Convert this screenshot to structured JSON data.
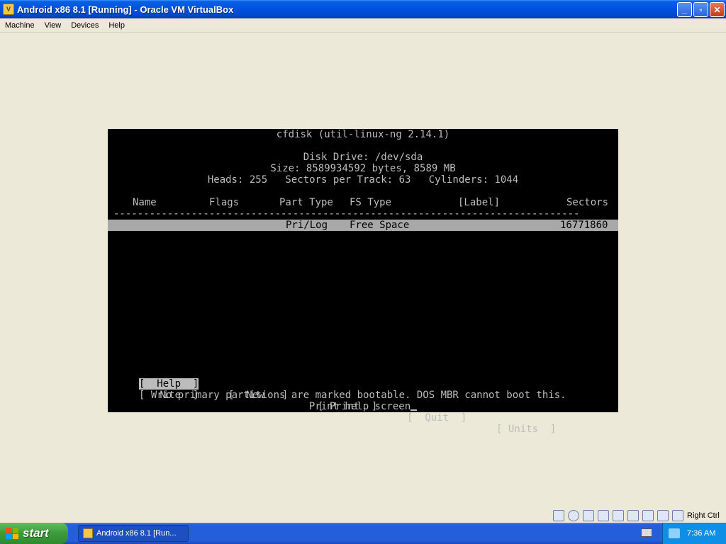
{
  "window": {
    "title": "Android x86 8.1 [Running] - Oracle VM VirtualBox",
    "icon": "virtualbox-icon"
  },
  "menubar": {
    "items": [
      "Machine",
      "View",
      "Devices",
      "Help"
    ]
  },
  "cfdisk": {
    "header": "cfdisk (util-linux-ng 2.14.1)",
    "disk_drive": "Disk Drive: /dev/sda",
    "size": "Size: 8589934592 bytes, 8589 MB",
    "geometry": "Heads: 255   Sectors per Track: 63   Cylinders: 1044",
    "columns": {
      "name": "Name",
      "flags": "Flags",
      "part_type": "Part Type",
      "fs_type": "FS Type",
      "label": "[Label]",
      "sectors": "Sectors"
    },
    "separator": "------------------------------------------------------------------------------",
    "rows": [
      {
        "part_type": "Pri/Log",
        "fs_type": "Free Space",
        "sectors": "16771860"
      }
    ],
    "buttons": [
      "[  Help  ]",
      "[  New   ]",
      "[ Print  ]",
      "[  Quit  ]",
      "[ Units  ]",
      "[ Write  ]"
    ],
    "selected_button": "[  Help  ]",
    "message": "No primary partitions are marked bootable. DOS MBR cannot boot this.",
    "hint": "Print help screen"
  },
  "vm_status": {
    "host_key": "Right Ctrl"
  },
  "taskbar": {
    "start_label": "start",
    "task_label": "Android x86 8.1 [Run...",
    "clock": "7:36 AM"
  }
}
